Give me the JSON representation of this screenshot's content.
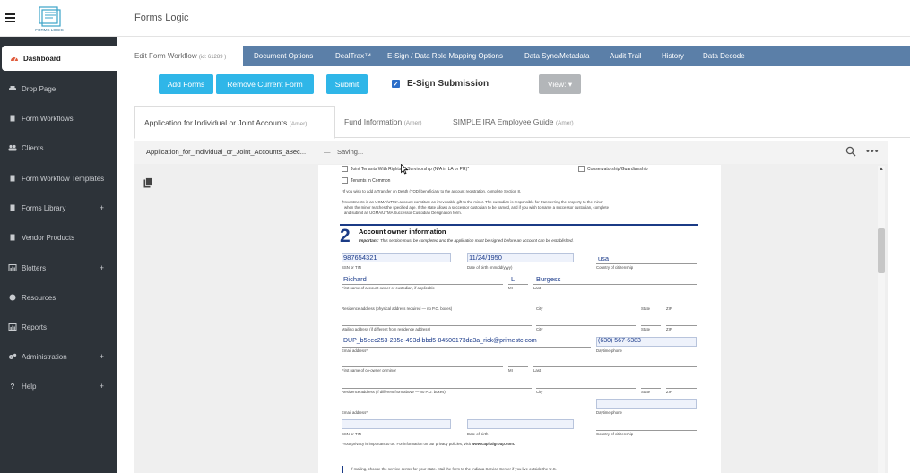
{
  "header": {
    "app_title": "Forms Logic",
    "logo_text": "FORMS LOGIC"
  },
  "sidebar": {
    "items": [
      {
        "label": "Dashboard",
        "icon": "dashboard-icon",
        "active": true
      },
      {
        "label": "Drop Page",
        "icon": "car-icon"
      },
      {
        "label": "Form Workflows",
        "icon": "document-icon"
      },
      {
        "label": "Clients",
        "icon": "users-icon"
      },
      {
        "label": "Form Workflow Templates",
        "icon": "document-icon"
      },
      {
        "label": "Forms Library",
        "icon": "document-icon",
        "expandable": true
      },
      {
        "label": "Vendor Products",
        "icon": "document-icon"
      },
      {
        "label": "Blotters",
        "icon": "chart-icon",
        "expandable": true
      },
      {
        "label": "Resources",
        "icon": "globe-icon"
      },
      {
        "label": "Reports",
        "icon": "chart-icon"
      },
      {
        "label": "Administration",
        "icon": "gear-icon",
        "expandable": true
      },
      {
        "label": "Help",
        "icon": "question-icon",
        "expandable": true
      }
    ],
    "expand_symbol": "+"
  },
  "workflow_tabs": {
    "active": {
      "label": "Edit Form Workflow",
      "id_label": "(id: 61289 )"
    },
    "tabs": [
      "Document Options",
      "DealTrax™",
      "E-Sign / Data Role Mapping Options",
      "Data Sync/Metadata",
      "Audit Trail",
      "History",
      "Data Decode"
    ]
  },
  "actions": {
    "add_forms": "Add Forms",
    "remove_current_form": "Remove Current Form",
    "submit": "Submit",
    "esign_label": "E-Sign Submission",
    "esign_checked": true,
    "view": "View: ▾"
  },
  "form_tabs": [
    {
      "label": "Application for Individual or Joint Accounts",
      "tag": "(Amer)",
      "active": true
    },
    {
      "label": "Fund Information",
      "tag": "(Amer)"
    },
    {
      "label": "SIMPLE IRA Employee Guide",
      "tag": "(Amer)"
    }
  ],
  "viewer": {
    "file_name": "Application_for_Individual_or_Joint_Accounts_a8ec...",
    "separator": "—",
    "status": "Saving..."
  },
  "document": {
    "checkbox_joint": "Joint Tenants With Rights of Survivorship (N/A in LA or PR)*",
    "checkbox_conservatorship": "Conservatorship/Guardianship",
    "checkbox_common": "Tenants in Common",
    "tod_note": "*If you wish to add a Transfer on Death (TOD) beneficiary to the account registration, complete Section 8.",
    "ugma_note_1": "†Investments in an UGMA/UTMA account constitute an irrevocable gift to the minor. The custodian is responsible for transferring the property to the minor",
    "ugma_note_2": "when the minor reaches the specified age. If the state allows a successor custodian to be named, and if you wish to name a successor custodian, complete",
    "ugma_note_3": "and submit an UGMA/UTMA Successor Custodian Designation form.",
    "section_number": "2",
    "section_title": "Account owner information",
    "section_note_bold": "Important:",
    "section_note": "This section must be completed and the application must be signed before an account can be established.",
    "ssn_value": "987654321",
    "ssn_label": "SSN or TIN",
    "dob_value": "11/24/1950",
    "dob_label": "Date of birth (mm/dd/yyyy)",
    "country_value": "usa",
    "country_label": "Country of citizenship",
    "first_name_value": "Richard",
    "first_name_label": "First name of account owner or custodian, if applicable",
    "mi_value": "L",
    "mi_label": "MI",
    "last_name_value": "Burgess",
    "last_name_label": "Last",
    "residence_label": "Residence address (physical address required — no P.O. boxes)",
    "city_label": "City",
    "state_label": "State",
    "zip_label": "ZIP",
    "mailing_label": "Mailing address (if different from residence address)",
    "email_value": "DUP_b5eec253-285e-493d-bbd5-84500173da3a_rick@primestc.com",
    "email_label": "Email address*",
    "phone_value": "(630) 567-6383",
    "phone_label": "Daytime phone",
    "co_first_name_label": "First name of co-owner or minor",
    "co_mi_label": "MI",
    "co_last_label": "Last",
    "co_residence_label": "Residence address (if different from above — no P.O. boxes)",
    "co_city_label": "City",
    "co_state_label": "State",
    "co_zip_label": "ZIP",
    "co_email_label": "Email address*",
    "co_phone_label": "Daytime phone",
    "co_ssn_label": "SSN or TIN",
    "co_dob_label": "Date of birth",
    "co_country_label": "Country of citizenship",
    "privacy_note": "*Your privacy is important to us. For information on our privacy policies, visit",
    "privacy_url": "www.capitalgroup.com.",
    "bottom_note": "If mailing, choose the service center for your state. Mail the form to the Indiana Service Center if you live outside the U.S."
  },
  "colors": {
    "sidebar_bg": "#2d3339",
    "tab_strip": "#5b7fa8",
    "button_primary": "#2fb6e8",
    "button_view": "#b3b6b9",
    "section_blue": "#1b3b86",
    "field_value": "#1a3a8a"
  }
}
